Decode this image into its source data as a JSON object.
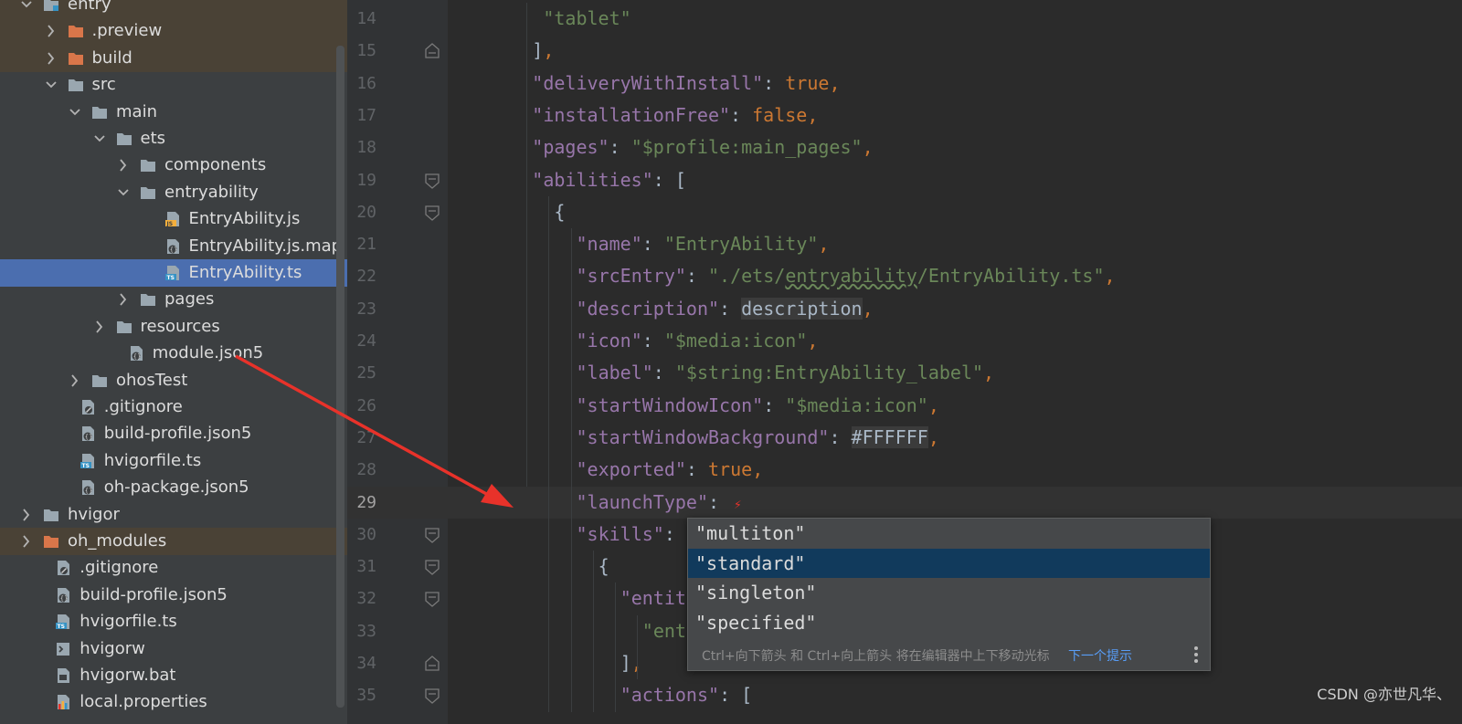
{
  "tree": [
    {
      "label": "entry",
      "depth": 0,
      "icon": "module-folder-icon",
      "chev": "down",
      "style": "excl"
    },
    {
      "label": ".preview",
      "depth": 1,
      "icon": "folder-orange-icon",
      "chev": "right",
      "style": "excl"
    },
    {
      "label": "build",
      "depth": 1,
      "icon": "folder-orange-icon",
      "chev": "right",
      "style": "excl"
    },
    {
      "label": "src",
      "depth": 1,
      "icon": "folder-icon",
      "chev": "down",
      "style": ""
    },
    {
      "label": "main",
      "depth": 2,
      "icon": "folder-icon",
      "chev": "down",
      "style": ""
    },
    {
      "label": "ets",
      "depth": 3,
      "icon": "folder-icon",
      "chev": "down",
      "style": ""
    },
    {
      "label": "components",
      "depth": 4,
      "icon": "folder-icon",
      "chev": "right",
      "style": ""
    },
    {
      "label": "entryability",
      "depth": 4,
      "icon": "folder-icon",
      "chev": "down",
      "style": ""
    },
    {
      "label": "EntryAbility.js",
      "depth": 5,
      "icon": "js-file-icon",
      "chev": "",
      "style": ""
    },
    {
      "label": "EntryAbility.js.map",
      "depth": 5,
      "icon": "json-file-icon",
      "chev": "",
      "style": ""
    },
    {
      "label": "EntryAbility.ts",
      "depth": 5,
      "icon": "ts-file-icon",
      "chev": "",
      "style": "sel"
    },
    {
      "label": "pages",
      "depth": 4,
      "icon": "folder-icon",
      "chev": "right",
      "style": ""
    },
    {
      "label": "resources",
      "depth": 3,
      "icon": "folder-icon",
      "chev": "right",
      "style": ""
    },
    {
      "label": "module.json5",
      "depth": 3.5,
      "icon": "json-file-icon",
      "chev": "",
      "style": ""
    },
    {
      "label": "ohosTest",
      "depth": 2,
      "icon": "folder-icon",
      "chev": "right",
      "style": ""
    },
    {
      "label": ".gitignore",
      "depth": 1.5,
      "icon": "gitignore-file-icon",
      "chev": "",
      "style": ""
    },
    {
      "label": "build-profile.json5",
      "depth": 1.5,
      "icon": "json-file-icon",
      "chev": "",
      "style": ""
    },
    {
      "label": "hvigorfile.ts",
      "depth": 1.5,
      "icon": "ts-file-icon",
      "chev": "",
      "style": ""
    },
    {
      "label": "oh-package.json5",
      "depth": 1.5,
      "icon": "json-file-icon",
      "chev": "",
      "style": ""
    },
    {
      "label": "hvigor",
      "depth": 0,
      "icon": "folder-icon",
      "chev": "right",
      "style": ""
    },
    {
      "label": "oh_modules",
      "depth": 0,
      "icon": "folder-orange-icon",
      "chev": "right",
      "style": "excl"
    },
    {
      "label": ".gitignore",
      "depth": 0.5,
      "icon": "gitignore-file-icon",
      "chev": "",
      "style": ""
    },
    {
      "label": "build-profile.json5",
      "depth": 0.5,
      "icon": "json-file-icon",
      "chev": "",
      "style": ""
    },
    {
      "label": "hvigorfile.ts",
      "depth": 0.5,
      "icon": "ts-file-icon",
      "chev": "",
      "style": ""
    },
    {
      "label": "hvigorw",
      "depth": 0.5,
      "icon": "shell-file-icon",
      "chev": "",
      "style": ""
    },
    {
      "label": "hvigorw.bat",
      "depth": 0.5,
      "icon": "bat-file-icon",
      "chev": "",
      "style": ""
    },
    {
      "label": "local.properties",
      "depth": 0.5,
      "icon": "properties-file-icon",
      "chev": "",
      "style": ""
    }
  ],
  "code_lines": [
    {
      "num": "14",
      "indent": 7,
      "fold": "",
      "tokens": [
        [
          "s",
          "\"tablet\""
        ]
      ]
    },
    {
      "num": "15",
      "indent": 6,
      "fold": "end",
      "tokens": [
        [
          "pl",
          "]"
        ],
        [
          "p",
          ","
        ]
      ]
    },
    {
      "num": "16",
      "indent": 6,
      "fold": "",
      "tokens": [
        [
          "k",
          "\"deliveryWithInstall\""
        ],
        [
          "pl",
          ": "
        ],
        [
          "kw",
          "true"
        ],
        [
          "p",
          ","
        ]
      ]
    },
    {
      "num": "17",
      "indent": 6,
      "fold": "",
      "tokens": [
        [
          "k",
          "\"installationFree\""
        ],
        [
          "pl",
          ": "
        ],
        [
          "kw",
          "false"
        ],
        [
          "p",
          ","
        ]
      ]
    },
    {
      "num": "18",
      "indent": 6,
      "fold": "",
      "tokens": [
        [
          "k",
          "\"pages\""
        ],
        [
          "pl",
          ": "
        ],
        [
          "s",
          "\"$profile:main_pages\""
        ],
        [
          "p",
          ","
        ]
      ]
    },
    {
      "num": "19",
      "indent": 6,
      "fold": "start",
      "tokens": [
        [
          "k",
          "\"abilities\""
        ],
        [
          "pl",
          ": ["
        ]
      ]
    },
    {
      "num": "20",
      "indent": 8,
      "fold": "start",
      "tokens": [
        [
          "pl",
          "{"
        ]
      ]
    },
    {
      "num": "21",
      "indent": 10,
      "fold": "",
      "tokens": [
        [
          "k",
          "\"name\""
        ],
        [
          "pl",
          ": "
        ],
        [
          "s",
          "\"EntryAbility\""
        ],
        [
          "p",
          ","
        ]
      ]
    },
    {
      "num": "22",
      "indent": 10,
      "fold": "",
      "tokens": [
        [
          "k",
          "\"srcEntry\""
        ],
        [
          "pl",
          ": "
        ],
        [
          "s",
          "\"./ets/"
        ],
        [
          "sw",
          "entryability"
        ],
        [
          "s",
          "/EntryAbility.ts\""
        ],
        [
          "p",
          ","
        ]
      ]
    },
    {
      "num": "23",
      "indent": 10,
      "fold": "",
      "tokens": [
        [
          "k",
          "\"description\""
        ],
        [
          "pl",
          ": "
        ],
        [
          "hl",
          "description"
        ],
        [
          "p",
          ","
        ]
      ]
    },
    {
      "num": "24",
      "indent": 10,
      "fold": "",
      "tokens": [
        [
          "k",
          "\"icon\""
        ],
        [
          "pl",
          ": "
        ],
        [
          "s",
          "\"$media:icon\""
        ],
        [
          "p",
          ","
        ]
      ]
    },
    {
      "num": "25",
      "indent": 10,
      "fold": "",
      "tokens": [
        [
          "k",
          "\"label\""
        ],
        [
          "pl",
          ": "
        ],
        [
          "s",
          "\"$string:EntryAbility_label\""
        ],
        [
          "p",
          ","
        ]
      ]
    },
    {
      "num": "26",
      "indent": 10,
      "fold": "",
      "tokens": [
        [
          "k",
          "\"startWindowIcon\""
        ],
        [
          "pl",
          ": "
        ],
        [
          "s",
          "\"$media:icon\""
        ],
        [
          "p",
          ","
        ]
      ]
    },
    {
      "num": "27",
      "indent": 10,
      "fold": "",
      "tokens": [
        [
          "k",
          "\"startWindowBackground\""
        ],
        [
          "pl",
          ": "
        ],
        [
          "hl",
          "#FFFFFF"
        ],
        [
          "p",
          ","
        ]
      ]
    },
    {
      "num": "28",
      "indent": 10,
      "fold": "",
      "tokens": [
        [
          "k",
          "\"exported\""
        ],
        [
          "pl",
          ": "
        ],
        [
          "kw",
          "true"
        ],
        [
          "p",
          ","
        ]
      ]
    },
    {
      "num": "29",
      "indent": 10,
      "fold": "",
      "cur": true,
      "tokens": [
        [
          "k",
          "\"launchType\""
        ],
        [
          "pl",
          ": "
        ]
      ]
    },
    {
      "num": "30",
      "indent": 10,
      "fold": "start",
      "tokens": [
        [
          "k",
          "\"skills\""
        ],
        [
          "pl",
          ": ["
        ]
      ]
    },
    {
      "num": "31",
      "indent": 12,
      "fold": "start",
      "tokens": [
        [
          "pl",
          "{"
        ]
      ]
    },
    {
      "num": "32",
      "indent": 14,
      "fold": "start",
      "tokens": [
        [
          "k",
          "\"entities"
        ]
      ]
    },
    {
      "num": "33",
      "indent": 16,
      "fold": "",
      "tokens": [
        [
          "s",
          "\"entity"
        ]
      ]
    },
    {
      "num": "34",
      "indent": 14,
      "fold": "end",
      "tokens": [
        [
          "pl",
          "]"
        ],
        [
          "p",
          ","
        ]
      ]
    },
    {
      "num": "35",
      "indent": 14,
      "fold": "start",
      "tokens": [
        [
          "k",
          "\"actions\""
        ],
        [
          "pl",
          ": ["
        ]
      ]
    }
  ],
  "completion": {
    "items": [
      "\"multiton\"",
      "\"standard\"",
      "\"singleton\"",
      "\"specified\""
    ],
    "selected_index": 1,
    "hint": "Ctrl+向下箭头 和 Ctrl+向上箭头 将在编辑器中上下移动光标",
    "next_tip": "下一个提示"
  },
  "watermark": "CSDN @亦世凡华、",
  "colors": {
    "sidebar_bg": "#3c3f41",
    "editor_bg": "#2b2b2b",
    "selection": "#4b6eaf",
    "arrow": "#e8322a",
    "key": "#9876aa",
    "string": "#6a8759",
    "keyword": "#cc7832"
  }
}
